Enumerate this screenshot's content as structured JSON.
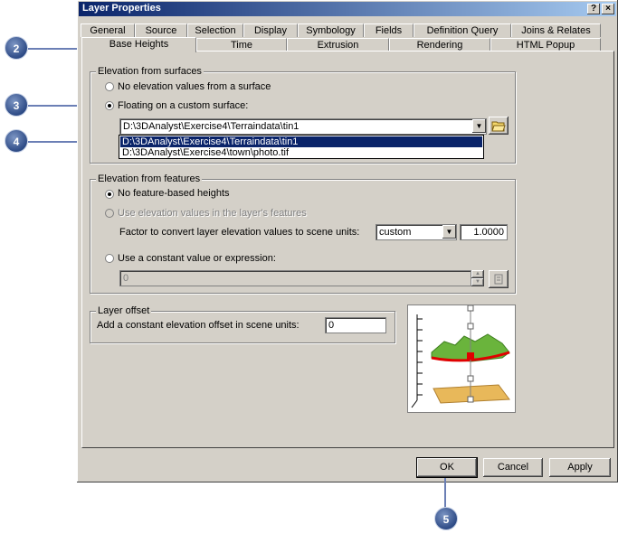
{
  "window": {
    "title": "Layer Properties",
    "help_label": "?",
    "close_label": "×"
  },
  "tabs_row1": [
    "General",
    "Source",
    "Selection",
    "Display",
    "Symbology",
    "Fields",
    "Definition Query",
    "Joins & Relates"
  ],
  "tabs_row2": [
    "Base Heights",
    "Time",
    "Extrusion",
    "Rendering",
    "HTML Popup"
  ],
  "active_tab": "Base Heights",
  "surfaces": {
    "title": "Elevation from surfaces",
    "option_none": "No elevation values from a surface",
    "option_floating": "Floating on a custom surface:",
    "surface_value": "D:\\3DAnalyst\\Exercise4\\Terraindata\\tin1",
    "dropdown_options": [
      "D:\\3DAnalyst\\Exercise4\\Terraindata\\tin1",
      "D:\\3DAnalyst\\Exercise4\\town\\photo.tif"
    ]
  },
  "features": {
    "title": "Elevation from features",
    "option_none": "No feature-based heights",
    "option_layer": "Use elevation values in the layer's features",
    "factor_label": "Factor to convert layer elevation values to scene units:",
    "factor_unit": "custom",
    "factor_value": "1.0000",
    "option_constant": "Use a constant value or expression:",
    "constant_value": "0"
  },
  "offset": {
    "title": "Layer offset",
    "label": "Add a constant elevation offset in scene units:",
    "value": "0"
  },
  "buttons": {
    "ok": "OK",
    "cancel": "Cancel",
    "apply": "Apply"
  },
  "callouts": [
    "2",
    "3",
    "4",
    "5"
  ],
  "colors": {
    "title_start": "#0a246a",
    "title_end": "#a6caf0",
    "callout": "#2e4b86",
    "selection": "#0a246a"
  }
}
